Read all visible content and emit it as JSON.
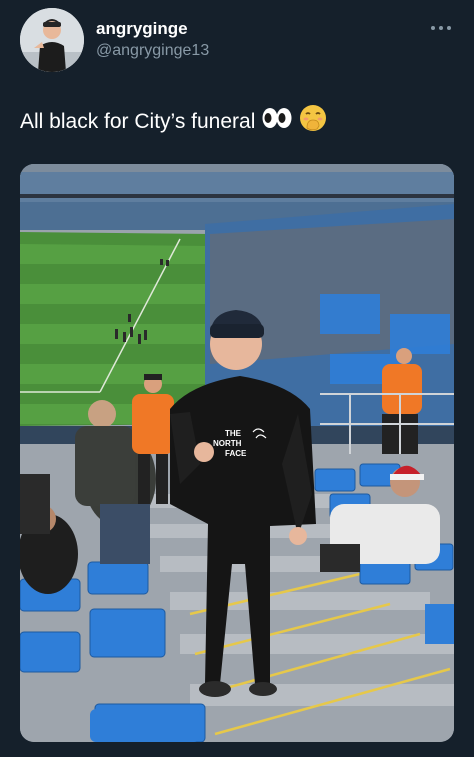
{
  "tweet": {
    "author": {
      "display_name": "angryginge",
      "handle": "@angryginge13"
    },
    "text": "All black for City’s funeral",
    "emojis": [
      "eyes-emoji",
      "hand-over-mouth-emoji"
    ],
    "photo": {
      "jacket_print": [
        "THE",
        "NORTH",
        "FACE"
      ]
    }
  },
  "colors": {
    "background": "#15202b",
    "secondary_text": "#8899a6",
    "seat_blue": "#2f7ed8",
    "pitch_green": "#4a8f3a"
  }
}
